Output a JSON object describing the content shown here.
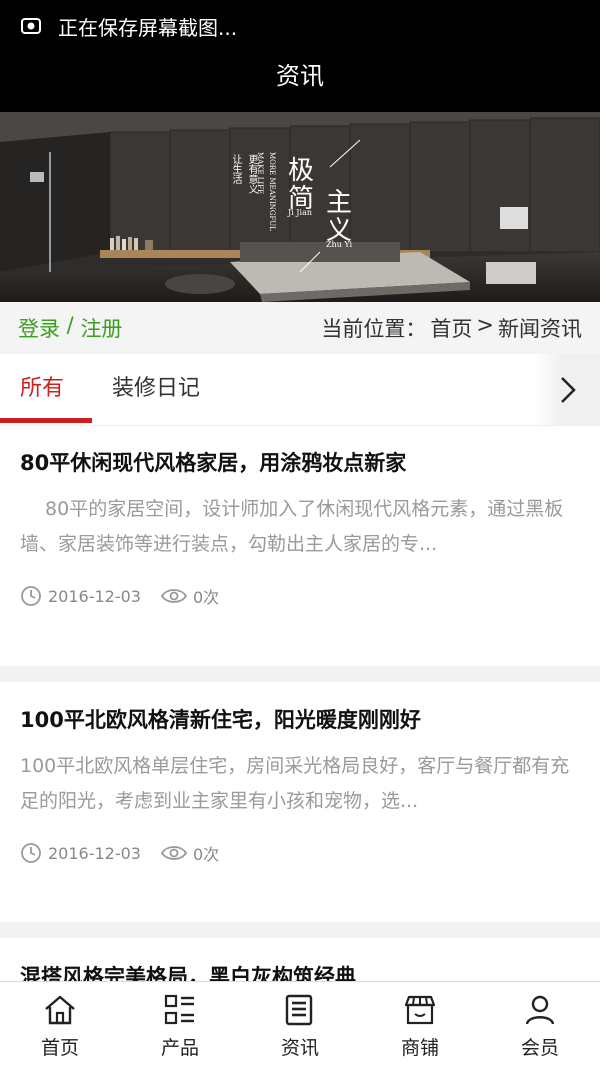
{
  "status": {
    "text": "正在保存屏幕截图..."
  },
  "header": {
    "title": "资讯"
  },
  "banner": {
    "big1": "极",
    "big2": "简",
    "big3": "主",
    "big4": "义",
    "small1": "更有意义",
    "small2": "让生活",
    "en1": "MORE MEANINGFUL",
    "en2": "MAKE LIFE",
    "pinyin1": "Ji Jian",
    "pinyin2": "Zhu Yi"
  },
  "location": {
    "login": "登录",
    "separator": " / ",
    "register": "注册",
    "prefix": "当前位置：",
    "home": "首页",
    "arrow": ">",
    "current": "新闻资讯"
  },
  "tabs": [
    {
      "label": "所有",
      "active": true
    },
    {
      "label": "装修日记",
      "active": false
    }
  ],
  "articles": [
    {
      "title": "80平休闲现代风格家居，用涂鸦妆点新家",
      "desc": "　 80平的家居空间，设计师加入了休闲现代风格元素，通过黑板墙、家居装饰等进行装点，勾勒出主人家居的专...",
      "date": "2016-12-03",
      "views": "0次"
    },
    {
      "title": "100平北欧风格清新住宅，阳光暖度刚刚好",
      "desc": "100平北欧风格单层住宅，房间采光格局良好，客厅与餐厅都有充足的阳光，考虑到业主家里有小孩和宠物，选...",
      "date": "2016-12-03",
      "views": "0次"
    },
    {
      "title": "混搭风格完美格局，黑白灰构筑经典"
    }
  ],
  "nav": [
    {
      "label": "首页",
      "icon": "home-icon"
    },
    {
      "label": "产品",
      "icon": "product-grid-icon"
    },
    {
      "label": "资讯",
      "icon": "news-icon"
    },
    {
      "label": "商铺",
      "icon": "shop-icon"
    },
    {
      "label": "会员",
      "icon": "user-icon"
    }
  ]
}
